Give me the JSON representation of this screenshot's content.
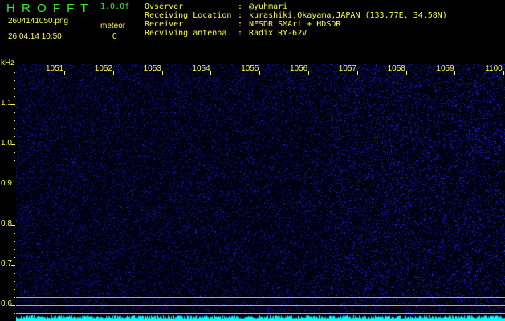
{
  "header": {
    "logo": "H R O F F T",
    "version": "1.0.0f",
    "filename": "2604141050.png",
    "datetime": "26.04.14 10:50",
    "meteor_label": "meteor",
    "meteor_count": "0",
    "info": [
      {
        "label": "Ovserver",
        "value": "@yuhmari"
      },
      {
        "label": "Receiving Location",
        "value": "kurashiki,Okayama,JAPAN (133.77E, 34.58N)"
      },
      {
        "label": "Receiver",
        "value": "NESDR SMArt + HDSDR"
      },
      {
        "label": "Recviving antenna",
        "value": "Radix RY-62V"
      }
    ]
  },
  "axes": {
    "unit": "kHz",
    "x_labels": [
      "1051",
      "1052",
      "1053",
      "1054",
      "1055",
      "1056",
      "1057",
      "1058",
      "1059",
      "1100"
    ],
    "y_labels": [
      "1.1",
      "1.0",
      "0.9",
      "0.8",
      "0.7",
      "0.6"
    ]
  },
  "colors": {
    "text": "#ffff33",
    "logo": "#33ee33",
    "spectrum": "#00ffff",
    "noise": "#2233ff"
  }
}
